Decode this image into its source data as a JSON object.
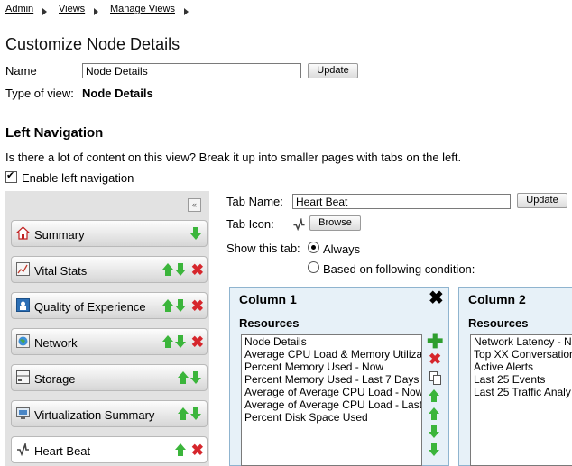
{
  "breadcrumb": [
    "Admin",
    "Views",
    "Manage Views"
  ],
  "page_title": "Customize Node Details",
  "name_label": "Name",
  "name_value": "Node Details",
  "update_label": "Update",
  "type_label": "Type of view:",
  "type_value": "Node Details",
  "left_nav": {
    "heading": "Left Navigation",
    "description": "Is there a lot of content on this view? Break it up into smaller pages with tabs on the left.",
    "enable_label": "Enable left navigation",
    "collapse_glyph": "«",
    "items": [
      {
        "label": "Summary",
        "icon": "home-icon"
      },
      {
        "label": "Vital Stats",
        "icon": "chart-icon"
      },
      {
        "label": "Quality of Experience",
        "icon": "qoe-icon"
      },
      {
        "label": "Network",
        "icon": "network-icon"
      },
      {
        "label": "Storage",
        "icon": "storage-icon"
      },
      {
        "label": "Virtualization Summary",
        "icon": "virtualization-icon"
      },
      {
        "label": "Heart Beat",
        "icon": "heartbeat-icon"
      }
    ]
  },
  "tab": {
    "name_label": "Tab Name:",
    "name_value": "Heart Beat",
    "update_label": "Update",
    "icon_label": "Tab Icon:",
    "browse_label": "Browse",
    "show_label": "Show this tab:",
    "option_always": "Always",
    "option_condition": "Based on following condition:"
  },
  "columns": [
    {
      "title": "Column 1",
      "resources_label": "Resources",
      "resources": [
        "Node Details",
        "Average CPU Load & Memory Utiliza",
        "Percent Memory Used - Now",
        "Percent Memory Used - Last 7 Days",
        "Average of Average CPU Load - Now",
        "Average of Average CPU Load - Last",
        "Percent Disk Space Used"
      ]
    },
    {
      "title": "Column 2",
      "resources_label": "Resources",
      "resources": [
        "Network Latency - No",
        "Top XX Conversation",
        "Active Alerts",
        "Last 25 Events",
        "Last 25 Traffic Analy"
      ]
    }
  ],
  "colors": {
    "accent_green": "#3bb53b",
    "delete_red": "#d6262c",
    "column_border": "#8fb4cf",
    "column_bg": "#e7f1f8"
  }
}
